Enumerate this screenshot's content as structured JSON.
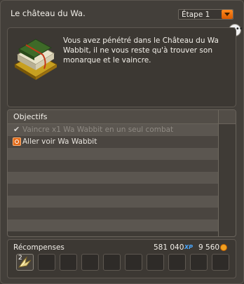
{
  "header": {
    "title": "Le château du Wa.",
    "step_select": "Étape 1"
  },
  "quest": {
    "description": "Vous avez pénétré dans le Château du Wa Wabbit, il ne vous reste qu'à trouver son monarque et le vaincre.",
    "icon": "book-icon"
  },
  "objectives": {
    "header": "Objectifs",
    "items": [
      {
        "text": "Vaincre x1 Wa Wabbit en un seul combat",
        "status": "done",
        "icon": "check-icon"
      },
      {
        "text": "Aller voir Wa Wabbit",
        "status": "active",
        "icon": "target-icon"
      }
    ]
  },
  "rewards": {
    "label": "Récompenses",
    "xp": "581 040",
    "xp_icon": "XP",
    "kamas": "9 560",
    "item_count": "2",
    "colors": {
      "accent": "#e06a1a",
      "xp": "#4aa8ff"
    }
  }
}
